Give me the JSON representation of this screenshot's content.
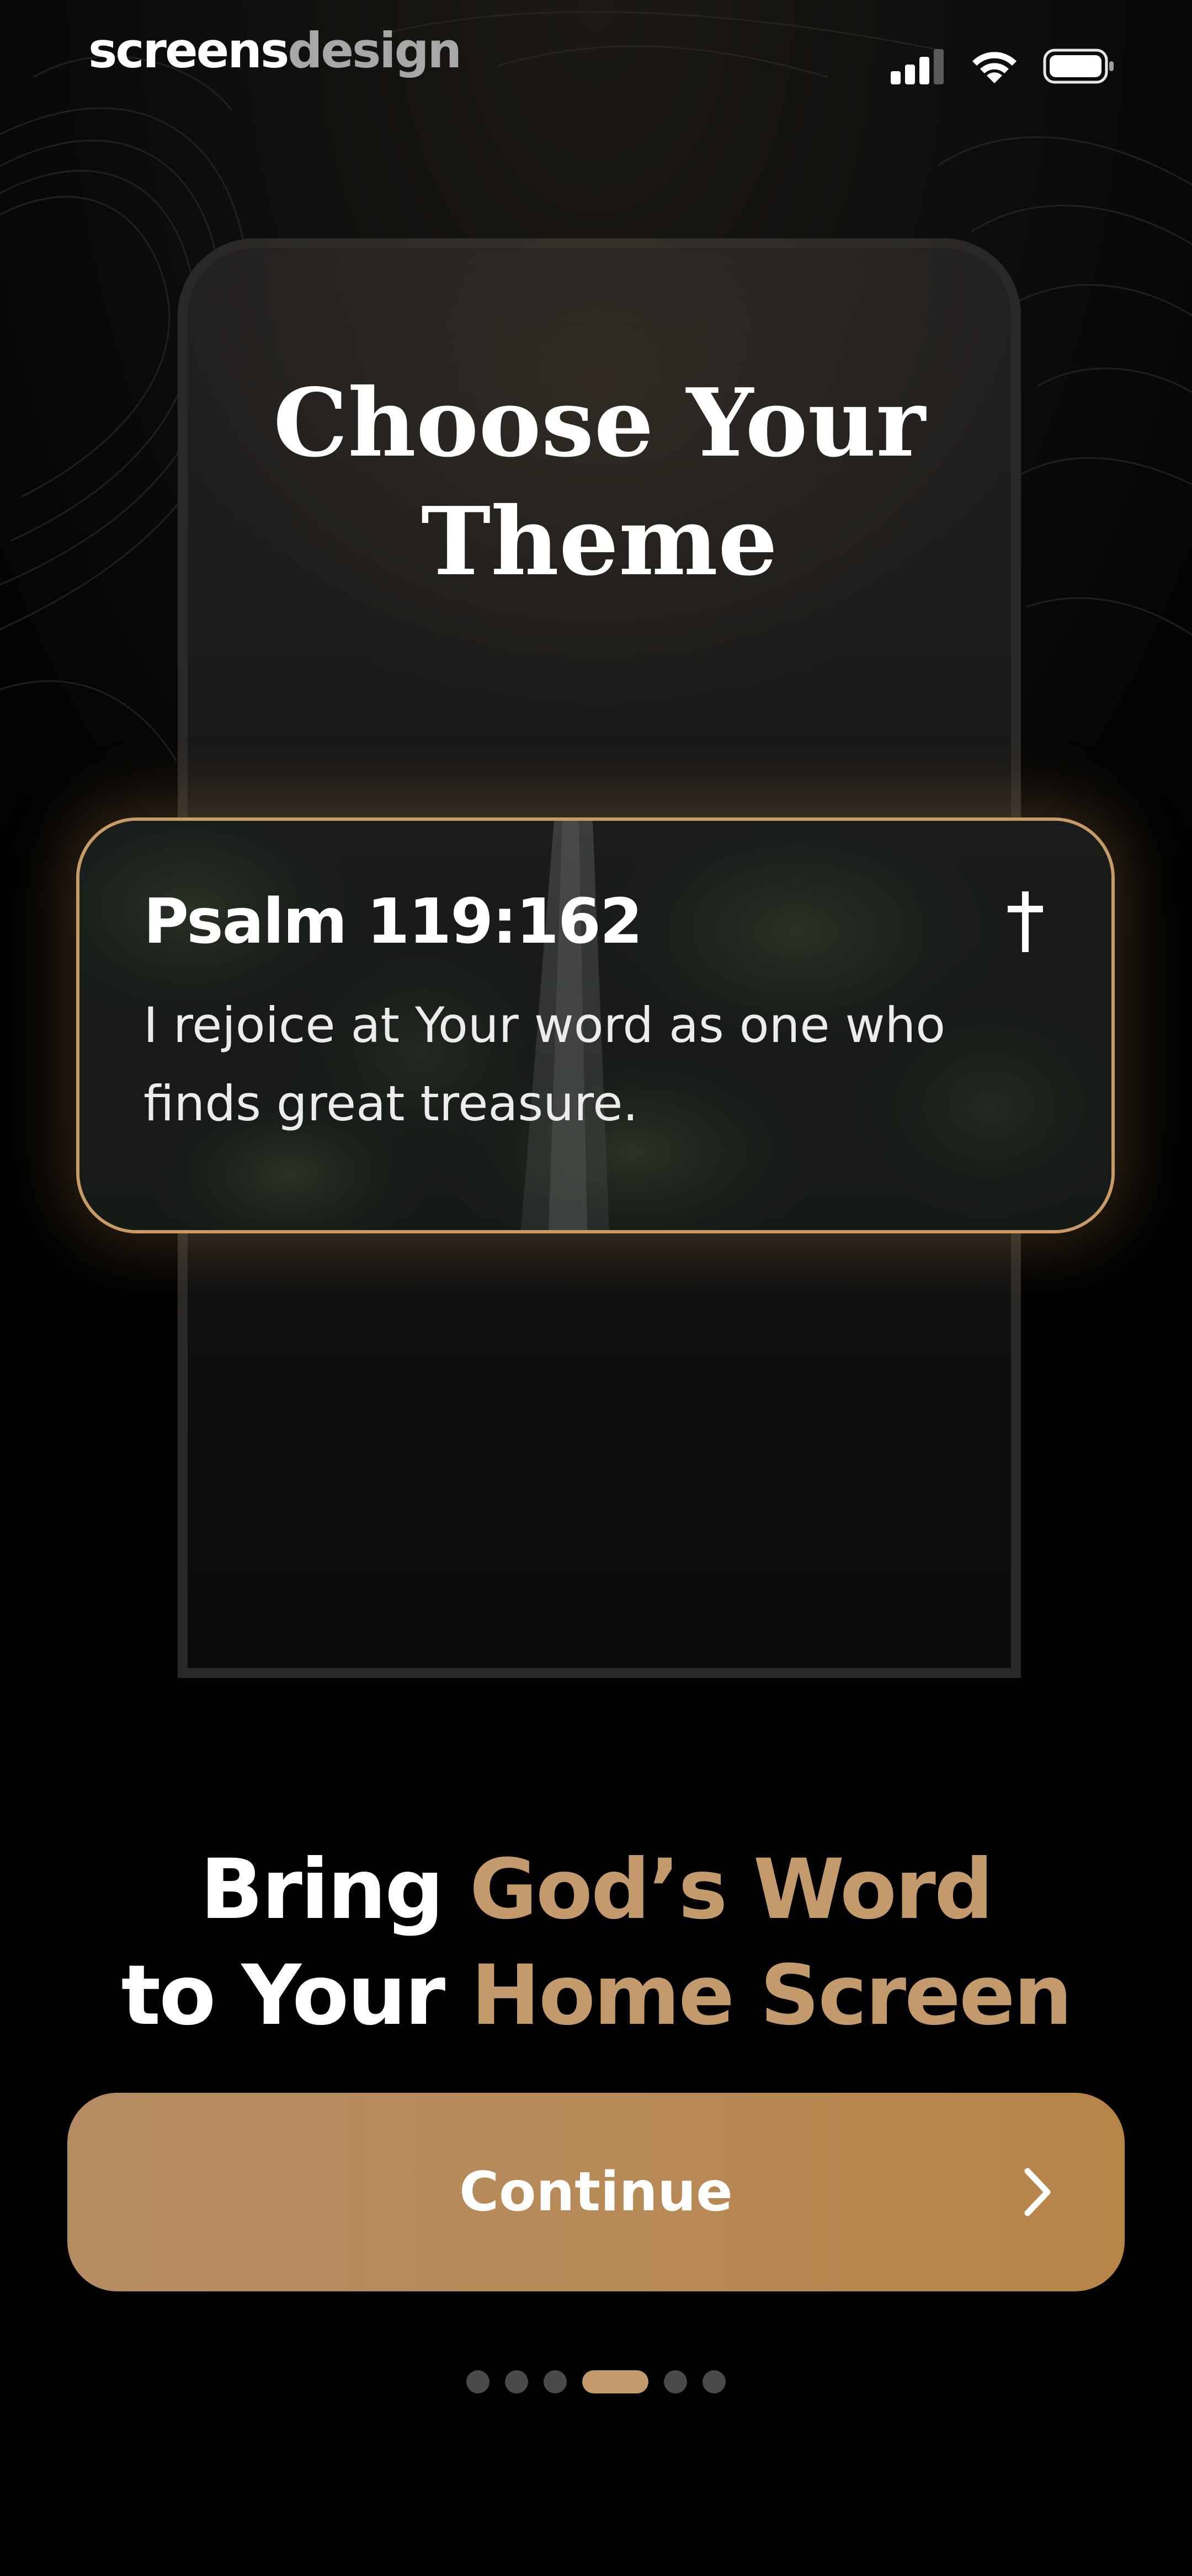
{
  "status_bar": {
    "brand_part1": "screens",
    "brand_part2": "design"
  },
  "phone": {
    "title_line1": "Choose Your",
    "title_line2": "Theme"
  },
  "widget": {
    "reference": "Psalm 119:162",
    "verse": "I rejoice at Your word as one who finds great treasure.",
    "icon": "cross-icon"
  },
  "headline": {
    "line1_white": "Bring ",
    "line1_gold": "God’s Word",
    "line2_white": "to Your ",
    "line2_gold": "Home Screen"
  },
  "continue_button": {
    "label": "Continue",
    "icon": "chevron-right-icon"
  },
  "pagination": {
    "total": 6,
    "active_index": 3
  },
  "colors": {
    "accent": "#c29a6c",
    "button": "#b78a5a",
    "background": "#000000"
  }
}
